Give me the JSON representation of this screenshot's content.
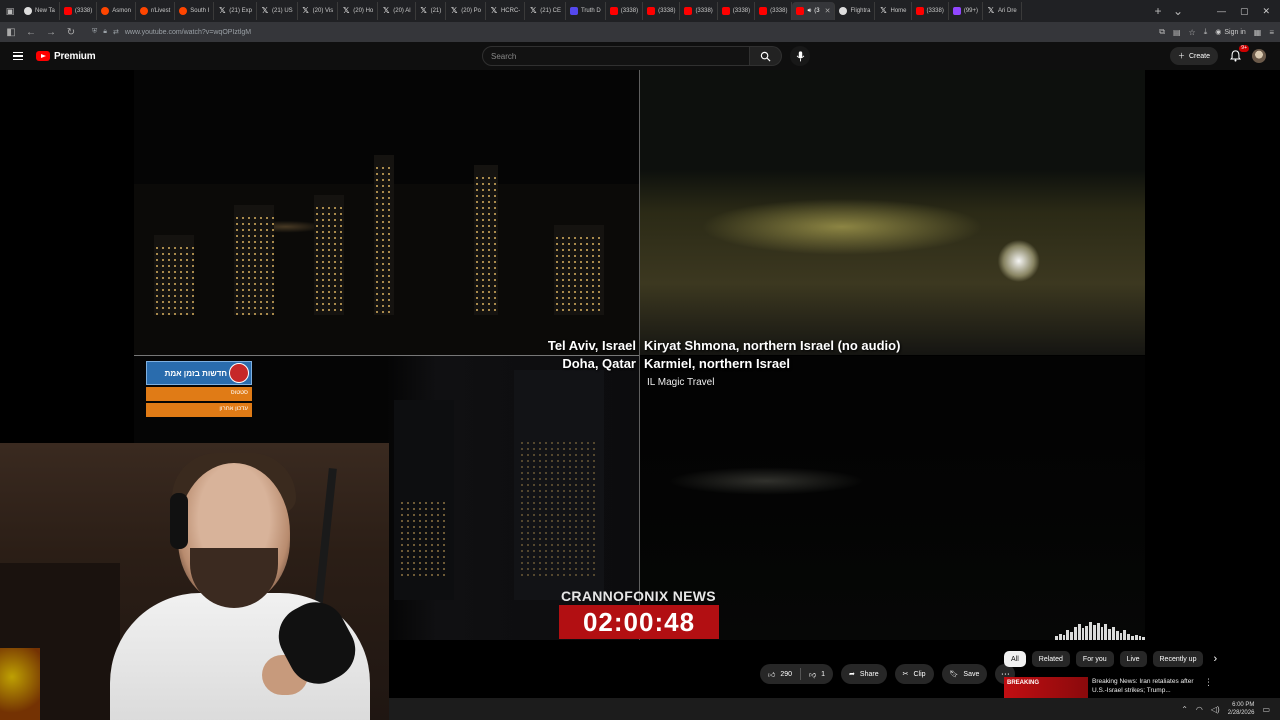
{
  "browser": {
    "tabs": [
      {
        "label": "New Ta",
        "icon": "globe-icon",
        "kind": "gh"
      },
      {
        "label": "(3338)",
        "icon": "youtube-icon",
        "kind": "yt"
      },
      {
        "label": "Asmon",
        "icon": "reddit-icon",
        "kind": "reddit"
      },
      {
        "label": "r/Livest",
        "icon": "reddit-icon",
        "kind": "reddit"
      },
      {
        "label": "South I",
        "icon": "reddit-icon",
        "kind": "reddit"
      },
      {
        "label": "(21) Exp",
        "icon": "x-icon",
        "kind": "x"
      },
      {
        "label": "(21) US",
        "icon": "x-icon",
        "kind": "x"
      },
      {
        "label": "(20) Vis",
        "icon": "x-icon",
        "kind": "x"
      },
      {
        "label": "(20) Ho",
        "icon": "x-icon",
        "kind": "x"
      },
      {
        "label": "(20) Al",
        "icon": "x-icon",
        "kind": "x"
      },
      {
        "label": "(21)",
        "icon": "x-icon",
        "kind": "x"
      },
      {
        "label": "(20) Po",
        "icon": "x-icon",
        "kind": "x"
      },
      {
        "label": "HCRC-",
        "icon": "x-icon",
        "kind": "x"
      },
      {
        "label": "(21) CE",
        "icon": "x-icon",
        "kind": "x"
      },
      {
        "label": "Truth D",
        "icon": "truth-social-icon",
        "kind": "truth"
      },
      {
        "label": "(3338)",
        "icon": "youtube-icon",
        "kind": "yt"
      },
      {
        "label": "(3338)",
        "icon": "youtube-icon",
        "kind": "yt"
      },
      {
        "label": "(3338)",
        "icon": "youtube-icon",
        "kind": "yt"
      },
      {
        "label": "(3338)",
        "icon": "youtube-icon",
        "kind": "yt"
      },
      {
        "label": "(3338)",
        "icon": "youtube-icon",
        "kind": "yt"
      },
      {
        "label": "(3",
        "icon": "youtube-icon",
        "kind": "yt",
        "active": true
      },
      {
        "label": "Flightra",
        "icon": "globe-icon",
        "kind": "gh"
      },
      {
        "label": "Home",
        "icon": "x-icon",
        "kind": "x"
      },
      {
        "label": "(3338)",
        "icon": "youtube-icon",
        "kind": "yt"
      },
      {
        "label": "(99+)",
        "icon": "twitch-icon",
        "kind": "tw"
      },
      {
        "label": "Ari Dre",
        "icon": "x-icon",
        "kind": "x"
      }
    ],
    "url": "www.youtube.com/watch?v=wqOPIztlgM",
    "signin_label": "Sign in"
  },
  "youtube": {
    "logo_text": "Premium",
    "search_placeholder": "Search",
    "create_label": "Create",
    "notif_count": "9+"
  },
  "video": {
    "cams": {
      "top_left": "Tel Aviv, Israel",
      "bottom_left": "Doha, Qatar",
      "top_right": "Kiryat Shmona, northern Israel (no audio)",
      "bottom_right": "Karmiel, northern Israel",
      "credit": "IL Magic Travel"
    },
    "widget": {
      "header": "חדשות בזמן אמת",
      "row1": "סטטוס",
      "row2": "עדכון אחרון"
    },
    "channel_name": "CRANNOFONIX NEWS",
    "countdown": "02:00:48"
  },
  "actions": {
    "like_count": "290",
    "dislike_count": "1",
    "share_label": "Share",
    "clip_label": "Clip",
    "save_label": "Save"
  },
  "chips": [
    "All",
    "Related",
    "For you",
    "Live",
    "Recently up"
  ],
  "recommendation": {
    "thumb_text": "BREAKING",
    "title": "Breaking News: Iran retaliates after U.S.-Israel strikes; Trump..."
  },
  "taskbar": {
    "time": "6:00 PM",
    "date": "2/28/2026"
  }
}
